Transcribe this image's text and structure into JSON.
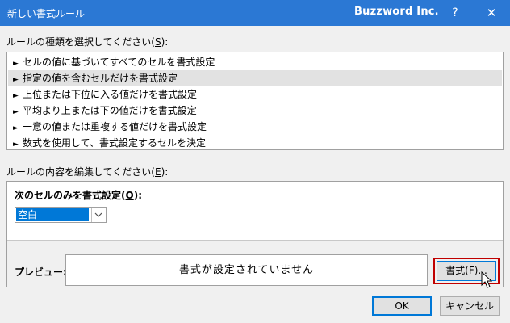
{
  "window": {
    "title": "新しい書式ルール",
    "brand": "Buzzword Inc.",
    "help_icon": "?",
    "close_icon": "✕"
  },
  "rule_type": {
    "label_pre": "ルールの種類を選択してください(",
    "label_key": "S",
    "label_post": "):",
    "items": [
      {
        "label": "セルの値に基づいてすべてのセルを書式設定",
        "selected": false
      },
      {
        "label": "指定の値を含むセルだけを書式設定",
        "selected": true
      },
      {
        "label": "上位または下位に入る値だけを書式設定",
        "selected": false
      },
      {
        "label": "平均より上または下の値だけを書式設定",
        "selected": false
      },
      {
        "label": "一意の値または重複する値だけを書式設定",
        "selected": false
      },
      {
        "label": "数式を使用して、書式設定するセルを決定",
        "selected": false
      }
    ]
  },
  "rule_edit": {
    "label_pre": "ルールの内容を編集してください(",
    "label_key": "E",
    "label_post": "):",
    "heading_pre": "次のセルのみを書式設定(",
    "heading_key": "O",
    "heading_post": "):",
    "condition_value": "空白"
  },
  "preview": {
    "label": "プレビュー:",
    "text": "書式が設定されていません",
    "format_button_pre": "書式(",
    "format_button_key": "F",
    "format_button_post": ")..."
  },
  "buttons": {
    "ok": "OK",
    "cancel": "キャンセル"
  },
  "colors": {
    "titlebar": "#2b78d4",
    "selection": "#0078d7",
    "highlight_border": "#c00000"
  }
}
